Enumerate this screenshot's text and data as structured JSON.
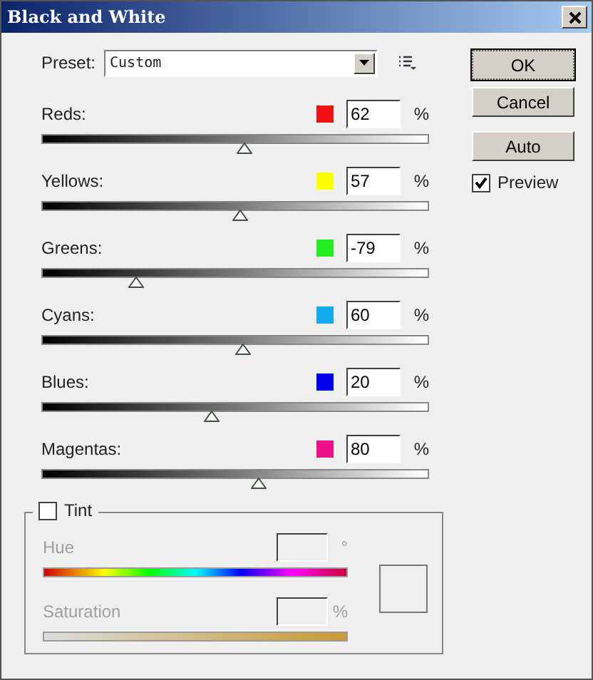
{
  "window": {
    "title": "Black and White"
  },
  "preset": {
    "label": "Preset:",
    "value": "Custom"
  },
  "channels": [
    {
      "name": "Reds:",
      "color": "#ee1111",
      "value": "62",
      "unit": "%",
      "level": 0.524
    },
    {
      "name": "Yellows:",
      "color": "#ffff00",
      "value": "57",
      "unit": "%",
      "level": 0.514
    },
    {
      "name": "Greens:",
      "color": "#22ee22",
      "value": "-79",
      "unit": "%",
      "level": 0.242
    },
    {
      "name": "Cyans:",
      "color": "#11aaee",
      "value": "60",
      "unit": "%",
      "level": 0.52
    },
    {
      "name": "Blues:",
      "color": "#0000ee",
      "value": "20",
      "unit": "%",
      "level": 0.44
    },
    {
      "name": "Magentas:",
      "color": "#ee1188",
      "value": "80",
      "unit": "%",
      "level": 0.56
    }
  ],
  "tint": {
    "label": "Tint",
    "checked": false,
    "hue": {
      "label": "Hue",
      "unit": "°"
    },
    "saturation": {
      "label": "Saturation",
      "unit": "%"
    }
  },
  "buttons": [
    {
      "label": "OK",
      "default": true
    },
    {
      "label": "Cancel",
      "default": false
    },
    {
      "label": "Auto",
      "default": false
    }
  ],
  "preview": {
    "label": "Preview",
    "checked": true
  }
}
